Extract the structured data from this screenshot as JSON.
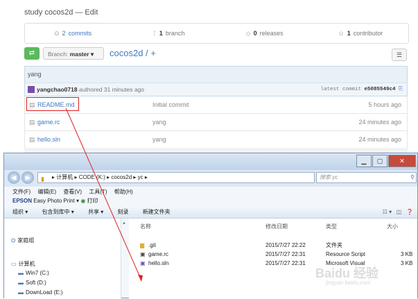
{
  "repo_description": "study cocos2d — Edit",
  "stats": [
    {
      "icon": "commits-icon",
      "glyph": "⊙",
      "num": "2",
      "label": "commits"
    },
    {
      "icon": "branch-icon",
      "glyph": "ᚴ",
      "num": "1",
      "label": "branch"
    },
    {
      "icon": "tag-icon",
      "glyph": "◇",
      "num": "0",
      "label": "releases"
    },
    {
      "icon": "contributor-icon",
      "glyph": "☺",
      "num": "1",
      "label": "contributor"
    }
  ],
  "branch": {
    "prefix": "Branch:",
    "name": "master ▾"
  },
  "repo_path": "cocos2d / +",
  "commit_message": "yang",
  "author": {
    "name": "yangchao0718",
    "action": "authored 31 minutes ago"
  },
  "latest_commit": {
    "label": "latest commit",
    "hash": "e5085549c4"
  },
  "files": [
    {
      "name": "README.md",
      "message": "Initial commit",
      "age": "5 hours ago"
    },
    {
      "name": "game.rc",
      "message": "yang",
      "age": "24 minutes ago"
    },
    {
      "name": "hello.sln",
      "message": "yang",
      "age": "24 minutes ago"
    }
  ],
  "explorer": {
    "address": "▸ 计算机 ▸ CODE (K:) ▸ cocos2d ▸ yc ▸",
    "search_placeholder": "搜索 yc",
    "menu": [
      "文件(F)",
      "编辑(E)",
      "查看(V)",
      "工具(T)",
      "帮助(H)"
    ],
    "epson": {
      "brand": "EPSON",
      "text": "Easy Photo Print ▾",
      "print": "打印"
    },
    "toolbar": [
      "组织 ▾",
      "包含到库中 ▾",
      "共享 ▾",
      "刻录",
      "新建文件夹"
    ],
    "nav": [
      {
        "label": "家庭组",
        "icon": "homegroup-icon",
        "glyph": "⛭"
      },
      {
        "label": "计算机",
        "icon": "computer-icon",
        "glyph": "▭"
      },
      {
        "label": "Win7 (C:)",
        "icon": "drive-icon",
        "glyph": "▬"
      },
      {
        "label": "Soft (D:)",
        "icon": "drive-icon",
        "glyph": "▬"
      },
      {
        "label": "DownLoad (E:)",
        "icon": "drive-icon",
        "glyph": "▬"
      }
    ],
    "columns": [
      "名称",
      "修改日期",
      "类型",
      "大小"
    ],
    "files": [
      {
        "name": ".git",
        "date": "2015/7/27 22:22",
        "type": "文件夹",
        "size": ""
      },
      {
        "name": "game.rc",
        "date": "2015/7/27 22:31",
        "type": "Resource Script",
        "size": "3 KB"
      },
      {
        "name": "hello.sln",
        "date": "2015/7/27 22:31",
        "type": "Microsoft Visual",
        "size": "3 KB"
      }
    ]
  },
  "watermark": {
    "line1": "Baidu 经验",
    "line2": "jingyan.baidu.com"
  }
}
